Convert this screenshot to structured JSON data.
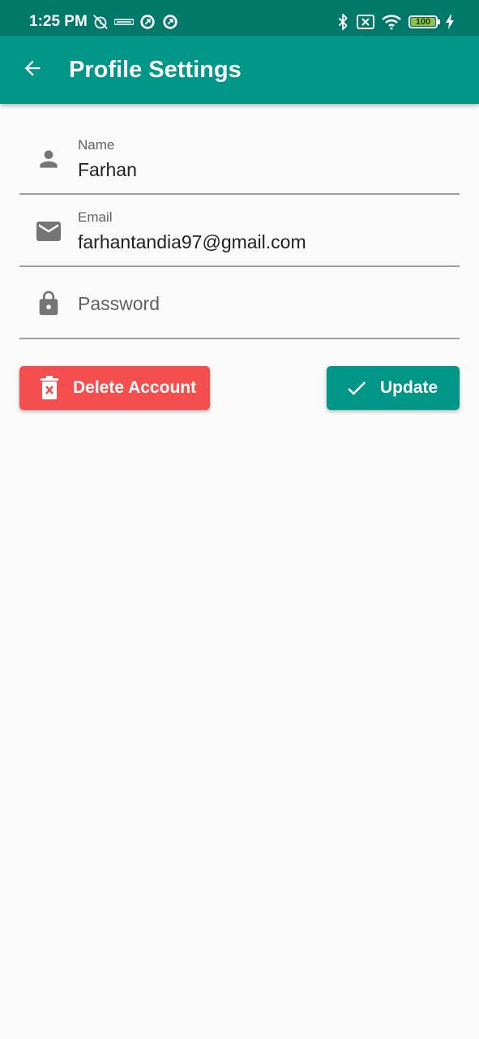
{
  "status_bar": {
    "time": "1:25 PM",
    "left_icons": [
      "alarm-off-icon",
      "hd-voice-icon",
      "data-saver-icon",
      "data-saver-icon"
    ],
    "right_icons": [
      "bluetooth-icon",
      "sim-off-icon",
      "wifi-icon",
      "battery-icon",
      "charging-icon"
    ],
    "battery": "100"
  },
  "app_bar": {
    "title": "Profile Settings",
    "back_icon": "arrow-back-icon",
    "color": "#009688",
    "status_color": "#00796b"
  },
  "form": {
    "name": {
      "label": "Name",
      "value": "Farhan",
      "icon": "person-icon"
    },
    "email": {
      "label": "Email",
      "value": "farhantandia97@gmail.com",
      "icon": "mail-icon"
    },
    "password": {
      "placeholder": "Password",
      "icon": "lock-icon"
    }
  },
  "actions": {
    "delete_label": "Delete Account",
    "delete_icon": "trash-icon",
    "delete_color": "#f44e4e",
    "update_label": "Update",
    "update_icon": "check-icon",
    "update_color": "#009688"
  }
}
